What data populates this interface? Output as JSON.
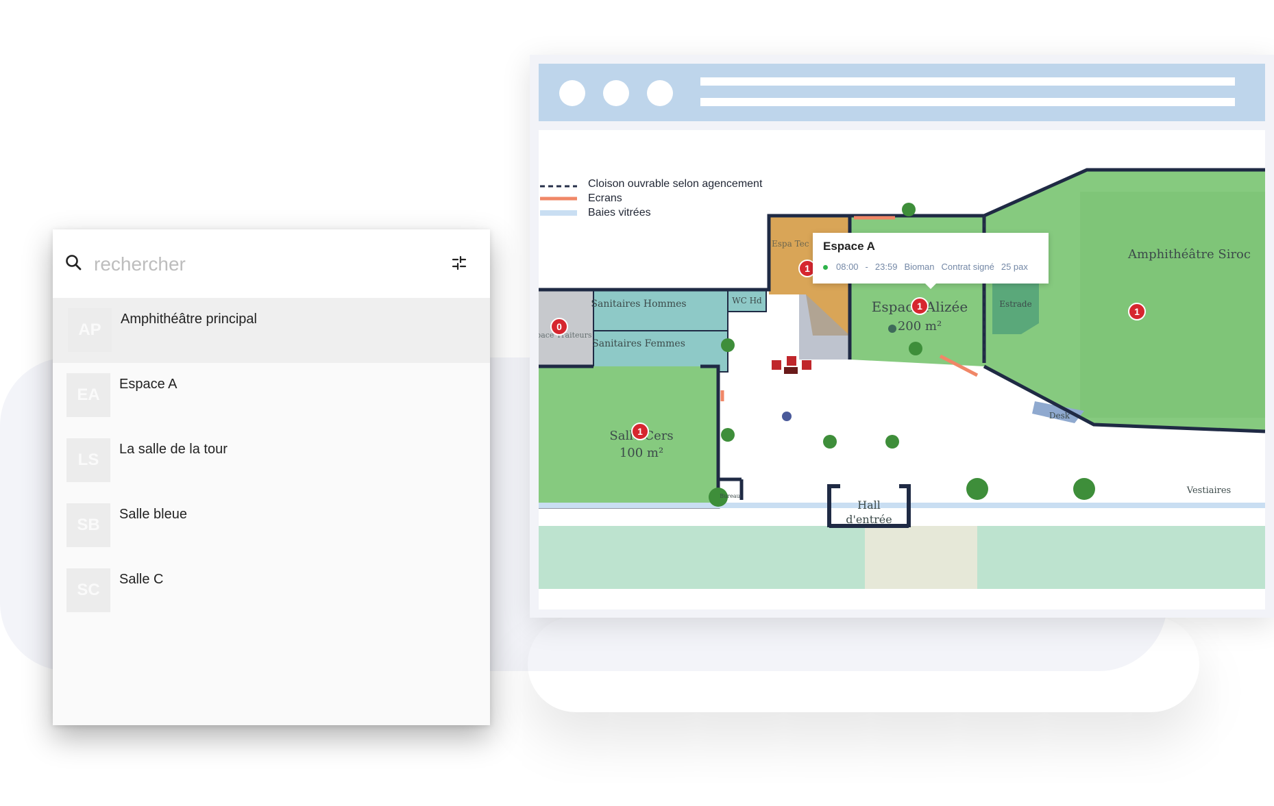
{
  "search": {
    "placeholder": "rechercher",
    "value": ""
  },
  "spaces": [
    {
      "initials": "AP",
      "name": "Amphithéâtre principal",
      "active": true
    },
    {
      "initials": "EA",
      "name": "Espace A",
      "active": false
    },
    {
      "initials": "LS",
      "name": "La salle de la tour",
      "active": false
    },
    {
      "initials": "SB",
      "name": "Salle bleue",
      "active": false
    },
    {
      "initials": "SC",
      "name": "Salle C",
      "active": false
    }
  ],
  "legend": {
    "items": [
      {
        "label": "Cloison ouvrable selon agencement",
        "style": "dashed",
        "color": "#27304a"
      },
      {
        "label": "Ecrans",
        "style": "solid",
        "color": "#f08767"
      },
      {
        "label": "Baies vitrées",
        "style": "solid",
        "color": "#c9def2"
      }
    ]
  },
  "rooms": {
    "sanitaires_hommes": "Sanitaires Hommes",
    "sanitaires_femmes": "Sanitaires Femmes",
    "wc_hd": "WC Hd",
    "espace_traiteurs": "Espace Traiteurs",
    "espace_technique": "Espa Tec",
    "espace_alizee": "Espace Alizée",
    "espace_alizee_area": "200 m²",
    "amphitheatre": "Amphithéâtre Siroc",
    "estrade": "Estrade",
    "salle_cers": "Salle Cers",
    "salle_cers_area": "100 m²",
    "desk": "Desk",
    "vestiaires": "Vestiaires",
    "hall": "Hall",
    "hall_line2": "d'entrée",
    "bureau": "Bureau"
  },
  "pins": [
    {
      "count": "0"
    },
    {
      "count": "1"
    },
    {
      "count": "1"
    },
    {
      "count": "1"
    },
    {
      "count": "1"
    }
  ],
  "tooltip": {
    "title": "Espace A",
    "status_color": "#2eb34a",
    "time_start": "08:00",
    "time_sep": "-",
    "time_end": "23:59",
    "client": "Bioman",
    "contract": "Contrat signé",
    "pax": "25 pax"
  },
  "colors": {
    "room_green": "#86ca7f",
    "room_teal": "#8ec9c7",
    "room_orange": "#d9a557",
    "room_grey": "#c7c9cd",
    "wall": "#1f2a44",
    "pin_red": "#d6262f",
    "browser_bar": "#bed5eb"
  }
}
